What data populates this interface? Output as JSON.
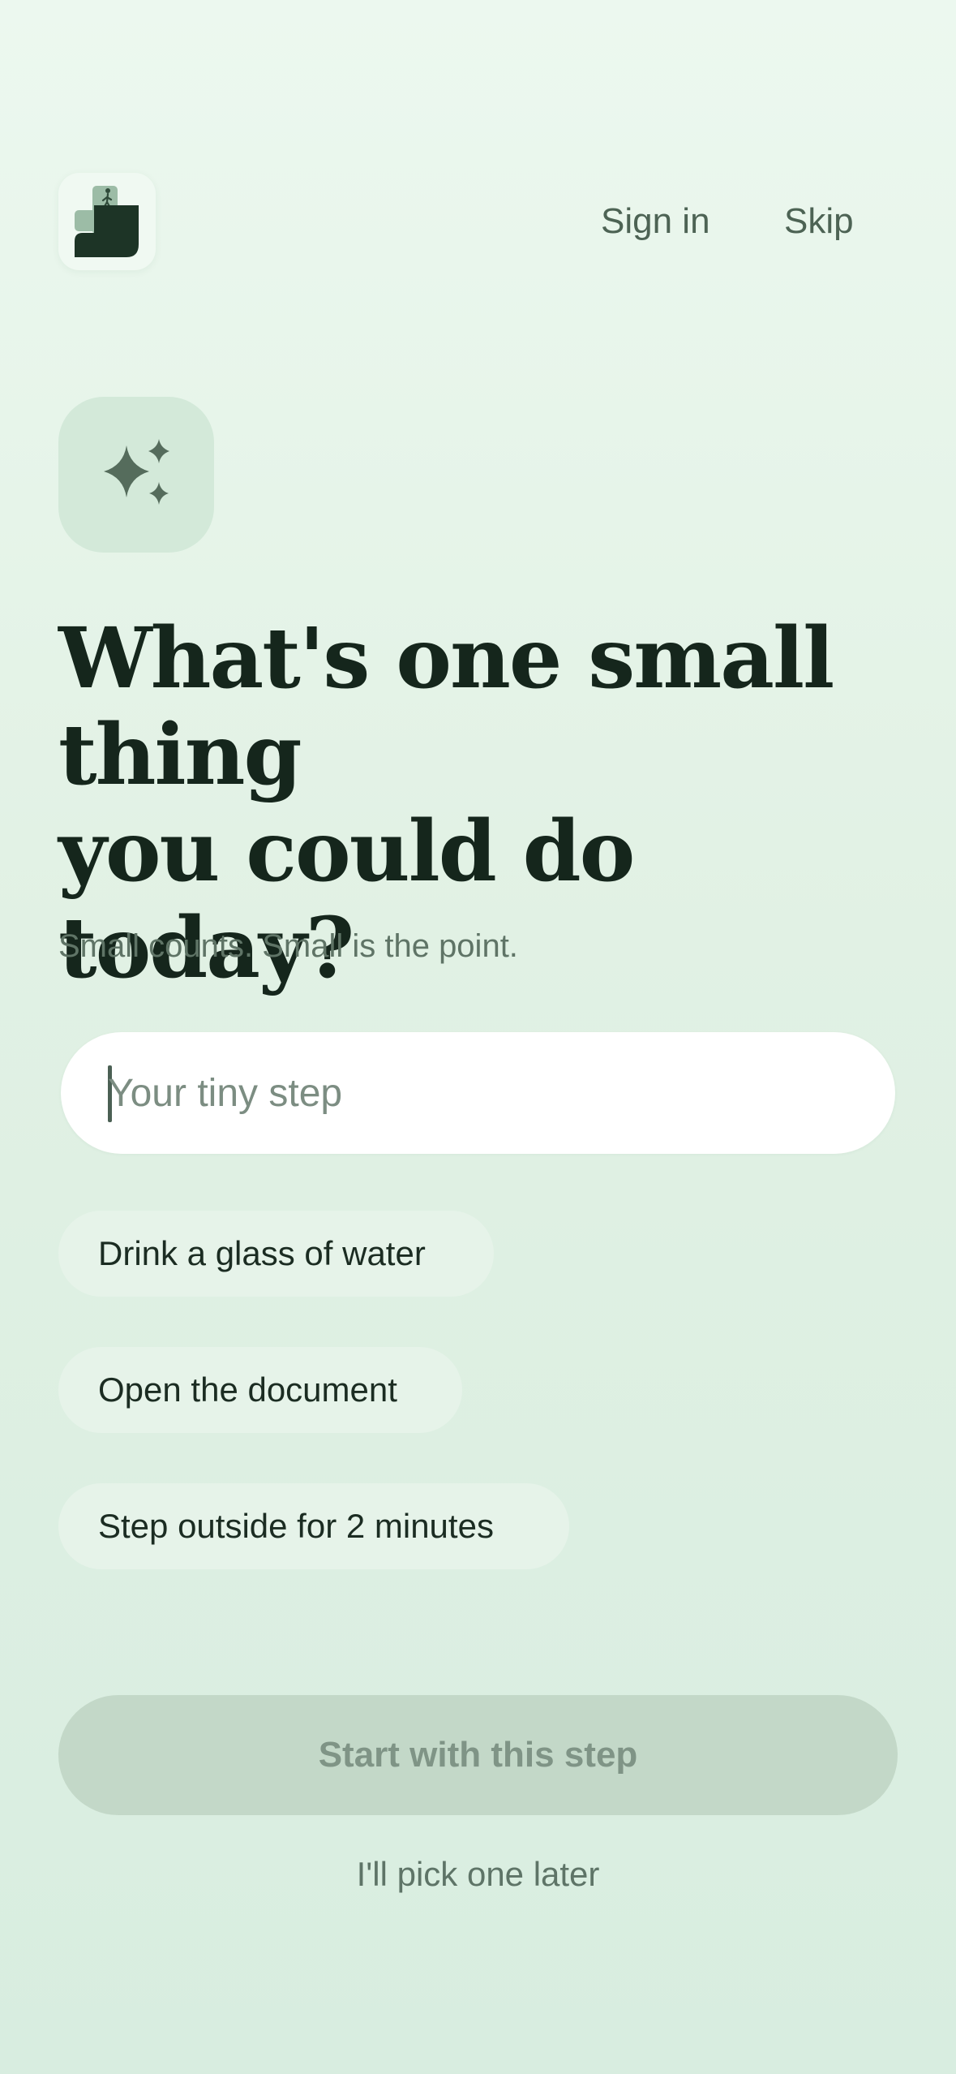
{
  "header": {
    "logo_icon": "stairs-logo-icon",
    "sign_in_label": "Sign in",
    "skip_label": "Skip"
  },
  "hero": {
    "icon": "sparkles-icon",
    "heading_line_1": "What's one small",
    "heading_line_2": "thing",
    "heading_line_3": "you could do today?",
    "subtitle": "Small counts. Small is the point."
  },
  "step_input": {
    "value": "",
    "placeholder": "Your tiny step"
  },
  "suggestions": [
    {
      "label": "Drink a glass of water"
    },
    {
      "label": "Open the document"
    },
    {
      "label": "Step outside for 2 minutes"
    }
  ],
  "actions": {
    "start_label": "Start with this step",
    "start_enabled": false,
    "later_label": "I'll pick one later"
  },
  "colors": {
    "background_top": "#ecf8ef",
    "background_bottom": "#d8ede0",
    "heading": "#15261c",
    "muted_text": "#5f7466",
    "chip_bg": "#e6f3e9",
    "button_disabled_bg": "#c3d8c8",
    "button_disabled_text": "#7f9486",
    "logo_dark": "#1d3426",
    "logo_light": "#9cbca6"
  }
}
